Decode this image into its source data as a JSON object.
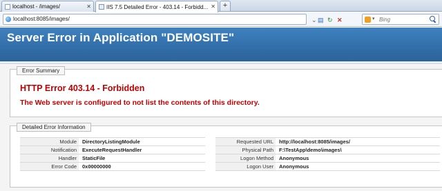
{
  "tabs": [
    {
      "title": "localhost - /images/",
      "active": false
    },
    {
      "title": "IIS 7.5 Detailed Error - 403.14 - Forbidd...",
      "active": true
    }
  ],
  "new_tab_label": "+",
  "address": {
    "url": "localhost:8085/images/"
  },
  "search": {
    "placeholder": "Bing",
    "engine_icon": "bing-icon"
  },
  "page": {
    "title": "Server Error in Application \"DEMOSITE\""
  },
  "error_summary": {
    "legend": "Error Summary",
    "title": "HTTP Error 403.14 - Forbidden",
    "description": "The Web server is configured to not list the contents of this directory."
  },
  "detailed_info": {
    "legend": "Detailed Error Information",
    "left": [
      {
        "label": "Module",
        "value": "DirectoryListingModule"
      },
      {
        "label": "Notification",
        "value": "ExecuteRequestHandler"
      },
      {
        "label": "Handler",
        "value": "StaticFile"
      },
      {
        "label": "Error Code",
        "value": "0x00000000"
      }
    ],
    "right": [
      {
        "label": "Requested URL",
        "value": "http://localhost:8085/images/"
      },
      {
        "label": "Physical Path",
        "value": "F:\\TestApp\\demo\\images\\"
      },
      {
        "label": "Logon Method",
        "value": "Anonymous"
      },
      {
        "label": "Logon User",
        "value": "Anonymous"
      }
    ]
  },
  "colors": {
    "header": "#336faa",
    "error_red": "#c00000"
  }
}
